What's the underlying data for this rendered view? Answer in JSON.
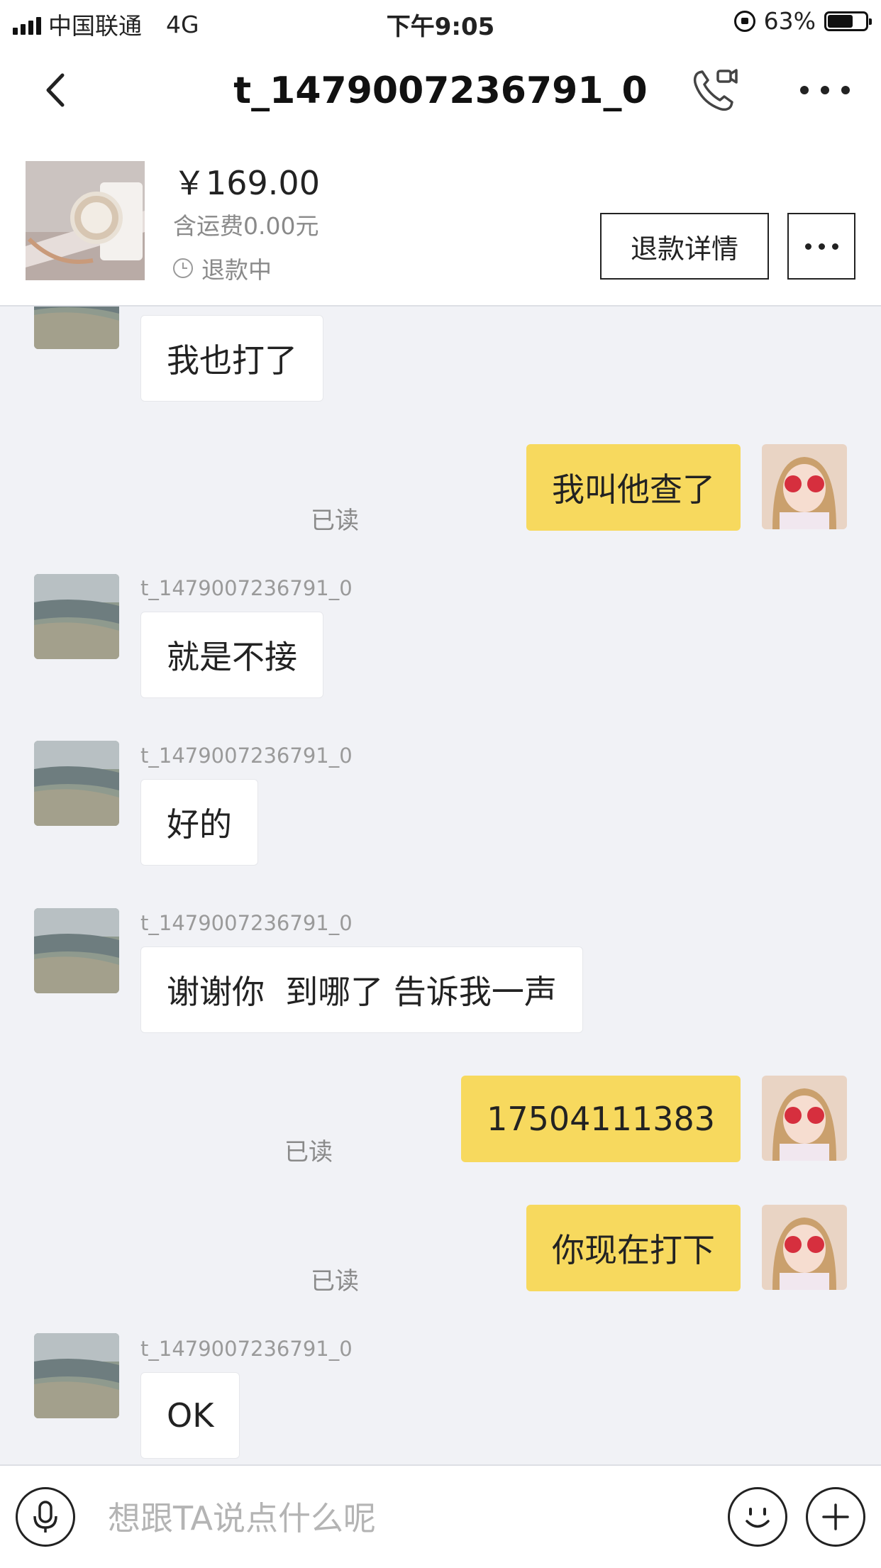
{
  "status_bar": {
    "carrier": "中国联通",
    "network": "4G",
    "time": "下午9:05",
    "battery": "63%",
    "battery_level": 0.63
  },
  "nav": {
    "title": "t_1479007236791_0",
    "icons": [
      "back-icon",
      "phone-video-icon",
      "more-icon"
    ]
  },
  "order": {
    "price": "￥169.00",
    "shipping": "含运费0.00元",
    "status": "退款中",
    "refund_button": "退款详情"
  },
  "messages": [
    {
      "side": "other",
      "sender": "",
      "text": "我也打了"
    },
    {
      "side": "self",
      "text": "我叫他查了",
      "read": "已读"
    },
    {
      "side": "other",
      "sender": "t_1479007236791_0",
      "text": "就是不接"
    },
    {
      "side": "other",
      "sender": "t_1479007236791_0",
      "text": "好的"
    },
    {
      "side": "other",
      "sender": "t_1479007236791_0",
      "text": "谢谢你  到哪了 告诉我一声"
    },
    {
      "side": "self",
      "text": "17504111383",
      "read": "已读"
    },
    {
      "side": "self",
      "text": "你现在打下",
      "read": "已读"
    },
    {
      "side": "other",
      "sender": "t_1479007236791_0",
      "text": "OK"
    }
  ],
  "input": {
    "placeholder": "想跟TA说点什么呢"
  },
  "colors": {
    "self_bubble": "#f7d95e",
    "other_bubble": "#ffffff",
    "chat_background": "#f1f2f6"
  }
}
